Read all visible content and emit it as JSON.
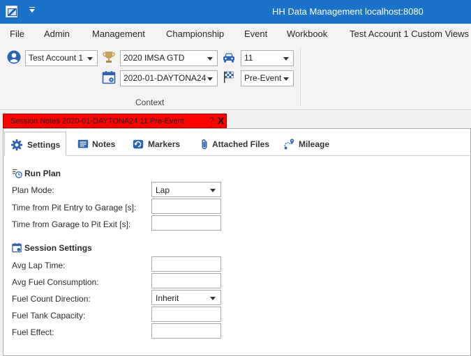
{
  "window": {
    "title": "HH Data Management localhost:8080",
    "icons": [
      "app-icon",
      "quick-access-arrow-icon"
    ]
  },
  "menu": {
    "items": [
      "File",
      "Admin",
      "Management",
      "Championship",
      "Event",
      "Workbook",
      "Test Account 1 Custom Views"
    ]
  },
  "ribbon": {
    "group_label": "Context",
    "account": {
      "icon": "user-icon",
      "value": "Test Account 1"
    },
    "championship": {
      "icon": "trophy-icon",
      "value": "2020 IMSA GTD"
    },
    "car": {
      "icon": "car-icon",
      "value": "11"
    },
    "event": {
      "icon": "calendar-icon",
      "value": "2020-01-DAYTONA24"
    },
    "session": {
      "icon": "checkered-flag-icon",
      "value": "Pre-Event"
    }
  },
  "document": {
    "tab_title": "Session Notes 2020-01-DAYTONA24 11 Pre-Event",
    "help": "?",
    "close": "X",
    "tab_color": "#ff0000"
  },
  "tabs": [
    {
      "label": "Settings",
      "icon": "gear-icon",
      "active": true
    },
    {
      "label": "Notes",
      "icon": "notes-icon",
      "active": false
    },
    {
      "label": "Markers",
      "icon": "markers-icon",
      "active": false
    },
    {
      "label": "Attached Files",
      "icon": "paperclip-icon",
      "active": false
    },
    {
      "label": "Mileage",
      "icon": "route-icon",
      "active": false
    }
  ],
  "run_plan": {
    "title": "Run Plan",
    "icon": "run-plan-icon",
    "plan_mode": {
      "label": "Plan Mode:",
      "value": "Lap"
    },
    "pit_entry_to_garage": {
      "label": "Time from Pit Entry to Garage [s]:",
      "value": ""
    },
    "garage_to_pit_exit": {
      "label": "Time from Garage to Pit Exit [s]:",
      "value": ""
    }
  },
  "session_settings": {
    "title": "Session Settings",
    "icon": "calendar-settings-icon",
    "avg_lap_time": {
      "label": "Avg Lap Time:",
      "value": ""
    },
    "avg_fuel_consumption": {
      "label": "Avg Fuel Consumption:",
      "value": ""
    },
    "fuel_count_direction": {
      "label": "Fuel Count Direction:",
      "value": "Inherit"
    },
    "fuel_tank_capacity": {
      "label": "Fuel Tank Capacity:",
      "value": ""
    },
    "fuel_effect": {
      "label": "Fuel Effect:",
      "value": ""
    }
  },
  "colors": {
    "titlebar": "#1a73c9",
    "accent_icon": "#2c64b0",
    "trophy": "#c9a05a",
    "chrome": "#f3f3f3"
  }
}
